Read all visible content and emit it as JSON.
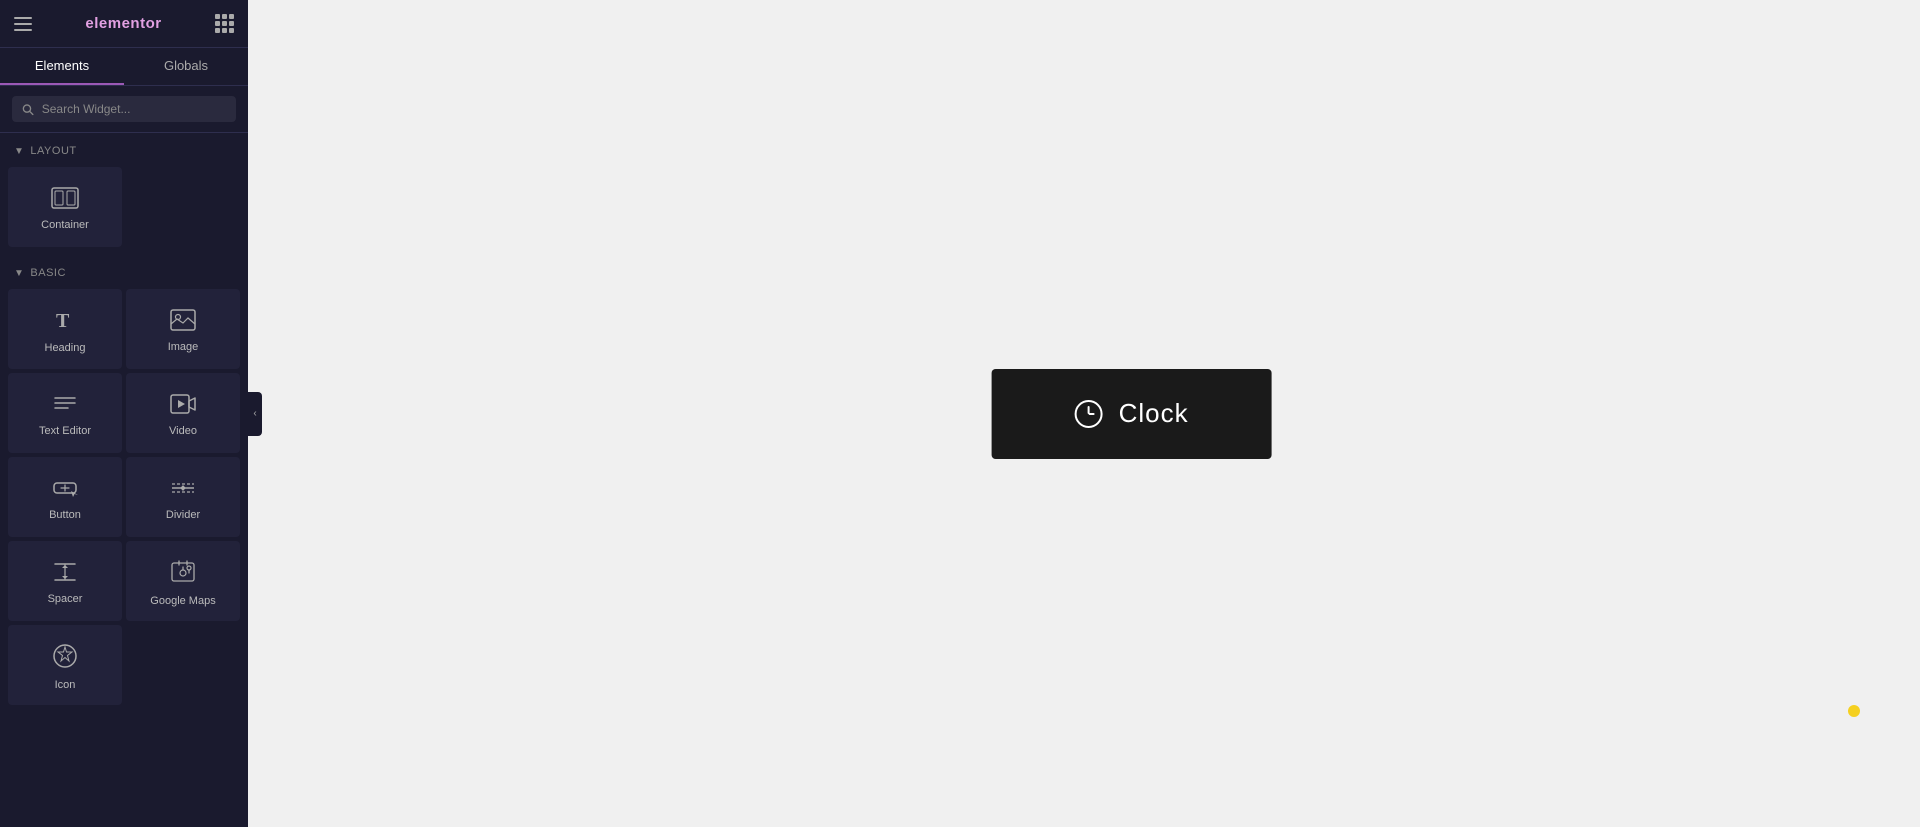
{
  "sidebar": {
    "logo": "elementor",
    "tabs": [
      {
        "label": "Elements",
        "active": true
      },
      {
        "label": "Globals",
        "active": false
      }
    ],
    "search": {
      "placeholder": "Search Widget..."
    },
    "sections": [
      {
        "name": "Layout",
        "widgets": [
          {
            "id": "container",
            "label": "Container",
            "icon": "⊞"
          }
        ]
      },
      {
        "name": "Basic",
        "widgets": [
          {
            "id": "heading",
            "label": "Heading",
            "icon": "T"
          },
          {
            "id": "image",
            "label": "Image",
            "icon": "🖼"
          },
          {
            "id": "text-editor",
            "label": "Text Editor",
            "icon": "≡"
          },
          {
            "id": "video",
            "label": "Video",
            "icon": "▷"
          },
          {
            "id": "button",
            "label": "Button",
            "icon": "⬜"
          },
          {
            "id": "divider",
            "label": "Divider",
            "icon": "÷"
          },
          {
            "id": "spacer",
            "label": "Spacer",
            "icon": "↕"
          },
          {
            "id": "google-maps",
            "label": "Google Maps",
            "icon": "📍"
          },
          {
            "id": "icon",
            "label": "Icon",
            "icon": "✦"
          }
        ]
      }
    ]
  },
  "canvas": {
    "clock_widget": {
      "label": "Clock"
    }
  }
}
